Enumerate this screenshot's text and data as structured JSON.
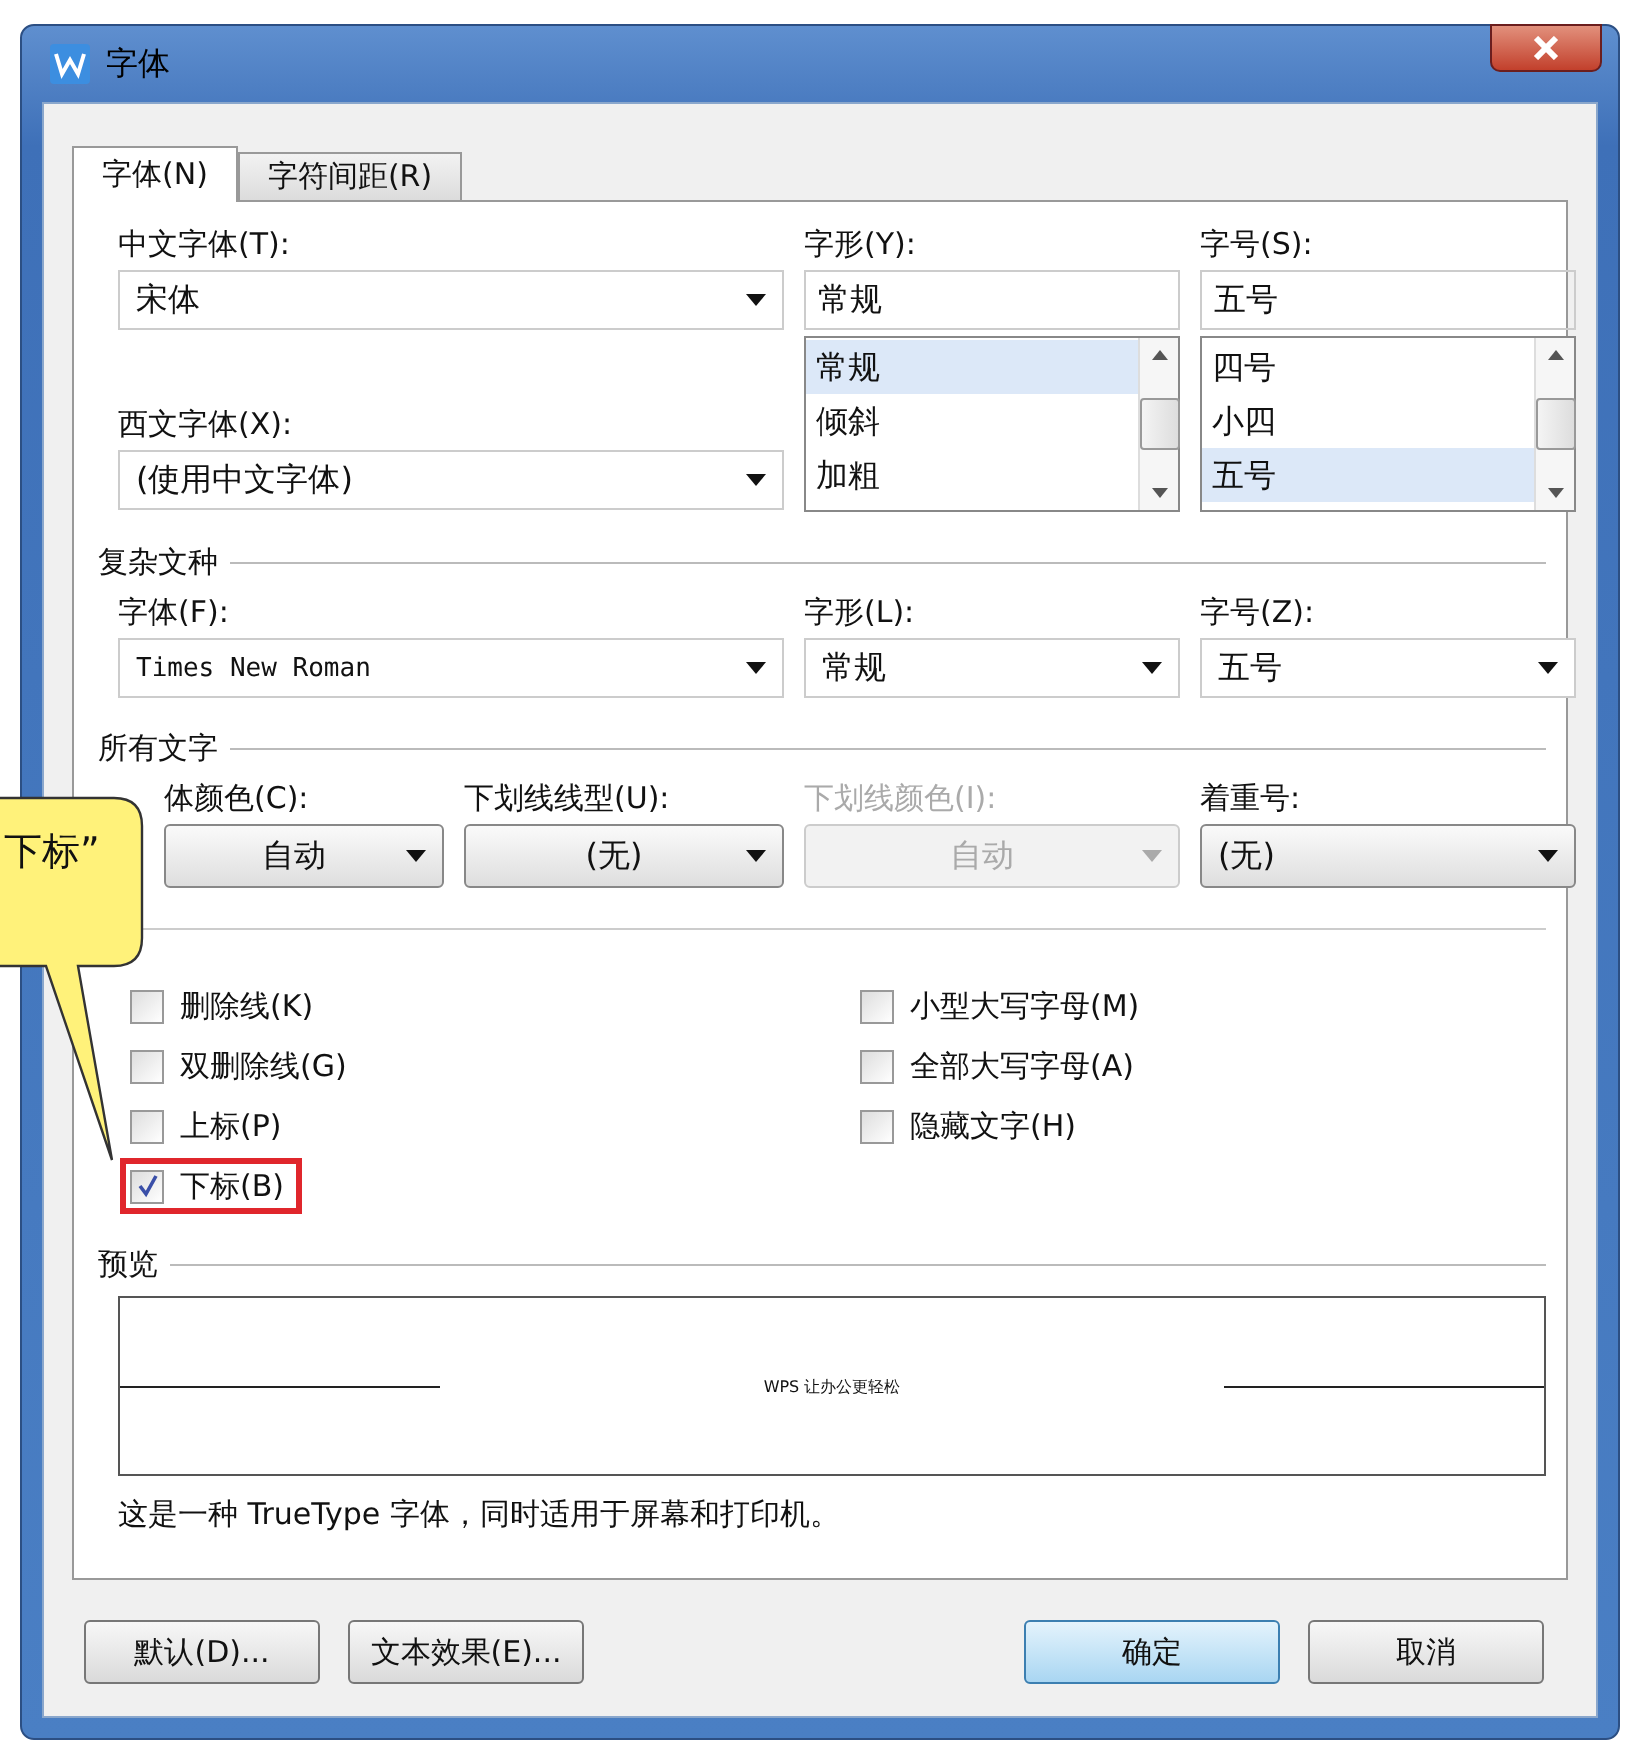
{
  "window": {
    "title": "字体"
  },
  "tabs": [
    {
      "label": "字体(N)",
      "selected": true
    },
    {
      "label": "字符间距(R)",
      "selected": false
    }
  ],
  "chinese_font": {
    "label": "中文字体(T):",
    "value": "宋体"
  },
  "western_font": {
    "label": "西文字体(X):",
    "value": "(使用中文字体)"
  },
  "style": {
    "label": "字形(Y):",
    "value": "常规",
    "options": [
      {
        "label": "常规",
        "selected": true
      },
      {
        "label": "倾斜",
        "selected": false
      },
      {
        "label": "加粗",
        "selected": false
      }
    ]
  },
  "size": {
    "label": "字号(S):",
    "value": "五号",
    "options": [
      {
        "label": "四号",
        "selected": false
      },
      {
        "label": "小四",
        "selected": false
      },
      {
        "label": "五号",
        "selected": true
      }
    ]
  },
  "complex_script": {
    "title": "复杂文种",
    "fields": [
      {
        "label": "字体(F):",
        "value": "Times New Roman"
      },
      {
        "label": "字形(L):",
        "value": "常规"
      },
      {
        "label": "字号(Z):",
        "value": "五号"
      }
    ]
  },
  "all_text": {
    "title": "所有文字",
    "fields": [
      {
        "label": "体颜色(C):",
        "value": "自动",
        "disabled": false
      },
      {
        "label": "下划线线型(U):",
        "value": "(无)",
        "disabled": false
      },
      {
        "label": "下划线颜色(I):",
        "value": "自动",
        "disabled": true
      },
      {
        "label": "着重号:",
        "value": "(无)",
        "disabled": false
      }
    ]
  },
  "effects": [
    {
      "label": "删除线(K)",
      "checked": false,
      "highlighted": false
    },
    {
      "label": "双删除线(G)",
      "checked": false,
      "highlighted": false
    },
    {
      "label": "上标(P)",
      "checked": false,
      "highlighted": false
    },
    {
      "label": "下标(B)",
      "checked": true,
      "highlighted": true
    },
    {
      "label": "小型大写字母(M)",
      "checked": false,
      "highlighted": false
    },
    {
      "label": "全部大写字母(A)",
      "checked": false,
      "highlighted": false
    },
    {
      "label": "隐藏文字(H)",
      "checked": false,
      "highlighted": false
    }
  ],
  "preview": {
    "title": "预览",
    "sample": "WPS 让办公更轻松",
    "note": "这是一种 TrueType 字体，同时适用于屏幕和打印机。"
  },
  "buttons": [
    {
      "label": "默认(D)...",
      "default": false
    },
    {
      "label": "文本效果(E)...",
      "default": false
    },
    {
      "label": "确定",
      "default": true
    },
    {
      "label": "取消",
      "default": false
    }
  ],
  "callout": {
    "text": "下标”"
  }
}
